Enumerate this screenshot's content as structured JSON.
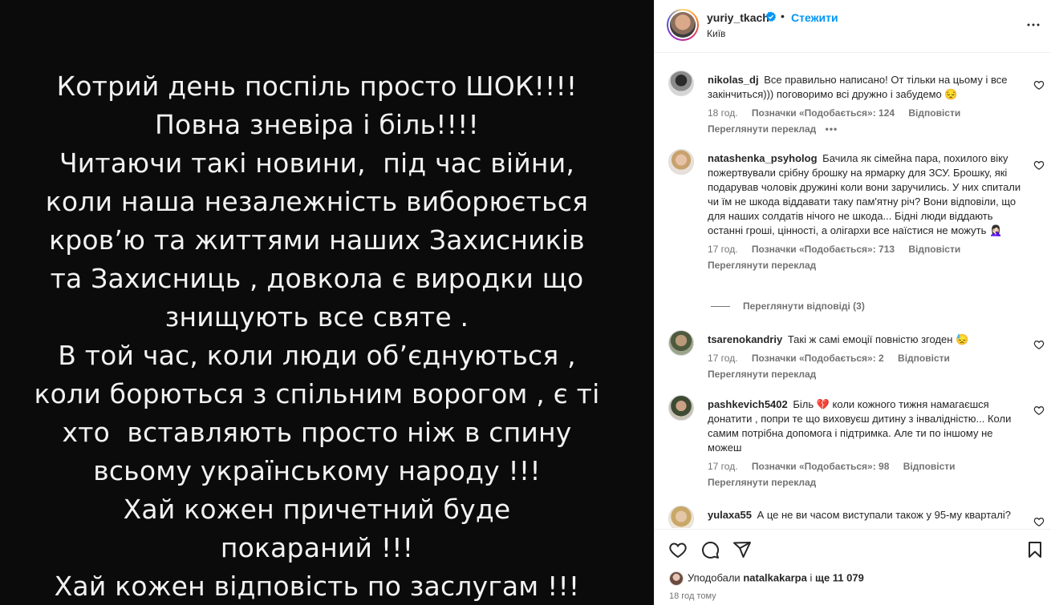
{
  "media": {
    "lines": [
      "Котрий день поспіль просто ШОК!!!!",
      "Повна зневіра і біль!!!!",
      "Читаючи такі новини,  під час війни,",
      "коли наша незалежність виборюється",
      "кров’ю та життями наших Захисників",
      "та Захисниць , довкола є виродки що",
      "знищують все святе .",
      "В той час, коли люди об’єднуються ,",
      "коли борються з спільним ворогом , є ті",
      "хто  вставляють просто ніж в спину",
      "всьому українському народу !!!",
      "Хай кожен причетний буде",
      "покараний !!!",
      "Хай кожен відповість по заслугам !!!"
    ]
  },
  "header": {
    "username": "yuriy_tkach",
    "separator": "•",
    "follow_label": "Стежити",
    "location": "Київ",
    "more_icon": "more-horizontal-icon"
  },
  "comments": [
    {
      "username": "nikolas_dj",
      "text": "Все правильно написано! От тільки на цьому і все закінчиться))) поговоримо всі дружно і забудемо 😔",
      "time": "18 год.",
      "likes": "Позначки «Подобається»: 124",
      "reply": "Відповісти",
      "translate": "Переглянути переклад",
      "dots": "•••"
    },
    {
      "username": "natashenka_psyholog",
      "text": "Бачила як сімейна пара, похилого віку пожертвували срібну брошку на ярмарку для ЗСУ. Брошку, які подарував чоловік дружині коли вони заручились. У них спитали чи їм не шкода віддавати таку пам'ятну річ? Вони відповіли, що для наших солдатів нічого не шкода... Бідні люди віддають останні гроші, цінності, а олігархи все наїстися не можуть 🤦🏻‍♀️",
      "time": "17 год.",
      "likes": "Позначки «Подобається»: 713",
      "reply": "Відповісти",
      "translate": "Переглянути переклад",
      "view_replies": "Переглянути відповіді (3)"
    },
    {
      "username": "tsarenokandriy",
      "text": "Такі ж самі емоції повністю згоден 😓",
      "time": "17 год.",
      "likes": "Позначки «Подобається»: 2",
      "reply": "Відповісти",
      "translate": "Переглянути переклад"
    },
    {
      "username": "pashkevich5402",
      "text": "Біль 💔  коли кожного тижня намагаєшся донатити , попри те що виховуєш дитину з інвалідністю... Коли самим потрібна допомога і підтримка. Але ти по іншому не можеш",
      "time": "17 год.",
      "likes": "Позначки «Подобається»: 98",
      "reply": "Відповісти",
      "translate": "Переглянути переклад"
    },
    {
      "username": "yulaxa55",
      "text": "А це не ви часом виступали також у 95-му кварталі?"
    }
  ],
  "actions": {
    "liked_by_prefix": "Уподобали",
    "liked_by_user": "natalkakarpa",
    "liked_by_and": "і",
    "liked_by_count": "ще 11 079",
    "time_ago": "18 год тому"
  }
}
